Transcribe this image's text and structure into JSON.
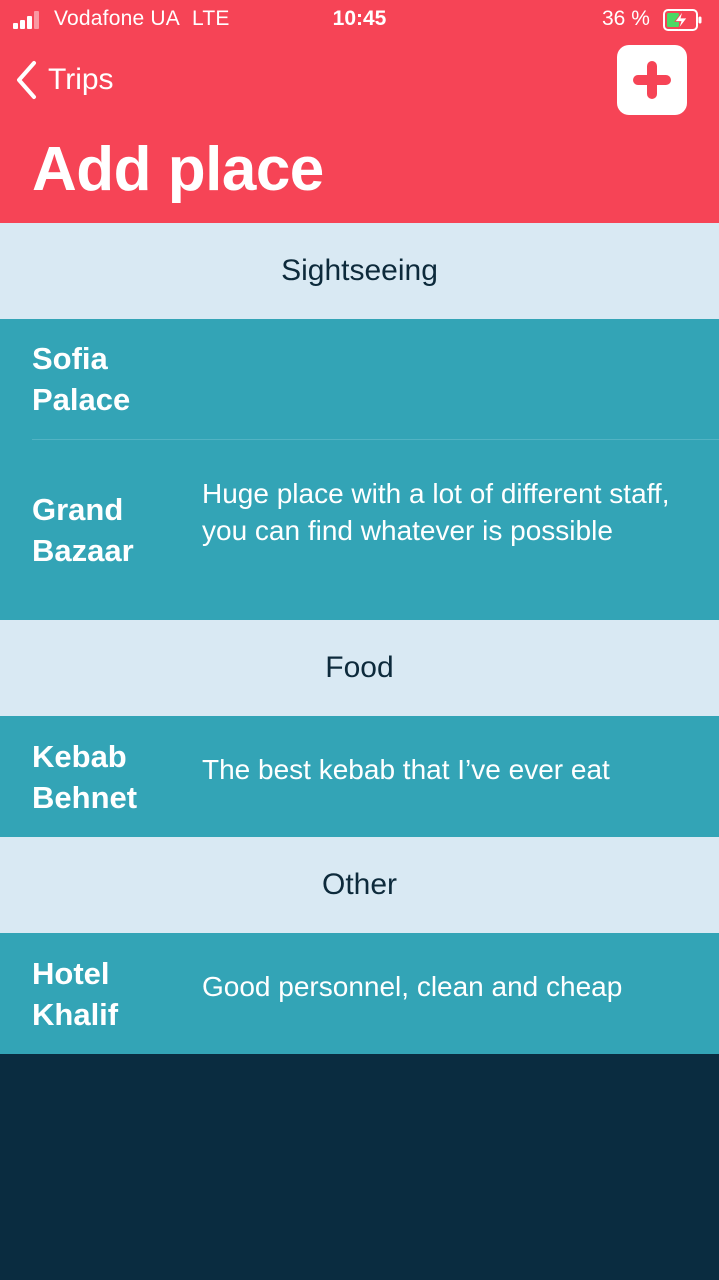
{
  "status_bar": {
    "carrier": "Vodafone UA",
    "network": "LTE",
    "time": "10:45",
    "battery": "36 %"
  },
  "nav": {
    "back_label": "Trips",
    "title": "Add place"
  },
  "colors": {
    "header": "#f64456",
    "section_bg": "#d9e9f3",
    "row_bg": "#33a4b6",
    "page_bg": "#0a2c40",
    "battery_fill": "#4cd964"
  },
  "sections": [
    {
      "label": "Sightseeing",
      "items": [
        {
          "name": "Sofia Palace",
          "description": ""
        },
        {
          "name": "Grand Bazaar",
          "description": "Huge place with a lot of different staff, you can find whatever is possible"
        }
      ]
    },
    {
      "label": "Food",
      "items": [
        {
          "name": "Kebab Behnet",
          "description": "The best kebab that I’ve ever eat"
        }
      ]
    },
    {
      "label": "Other",
      "items": [
        {
          "name": "Hotel Khalif",
          "description": "Good personnel, clean and cheap"
        }
      ]
    }
  ]
}
